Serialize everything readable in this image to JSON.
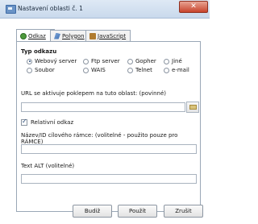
{
  "window": {
    "title": "Nastavení oblasti č. 1",
    "close": "✕"
  },
  "tabs": [
    {
      "label": "Odkaz",
      "icon": "link-icon"
    },
    {
      "label": "Polygon",
      "icon": "polygon-icon"
    },
    {
      "label": "JavaScript",
      "icon": "javascript-icon"
    }
  ],
  "link_type": {
    "title": "Typ odkazu",
    "options": [
      "Webový server",
      "Ftp server",
      "Gopher",
      "Jiné",
      "Soubor",
      "WAIS",
      "Telnet",
      "e-mail"
    ],
    "selected": "Webový server"
  },
  "url": {
    "label": "URL se aktivuje poklepem na tuto oblast: (povinné)",
    "value": ""
  },
  "relative": {
    "label": "Relativní odkaz",
    "checked": true
  },
  "target": {
    "label": "Název/ID cílového rámce: (volitelné - použito pouze pro RÁMCE)",
    "value": ""
  },
  "alt": {
    "label": "Text ALT (volitelné)",
    "value": ""
  },
  "buttons": {
    "ok": "Budiž",
    "apply": "Použít",
    "cancel": "Zrušit"
  }
}
